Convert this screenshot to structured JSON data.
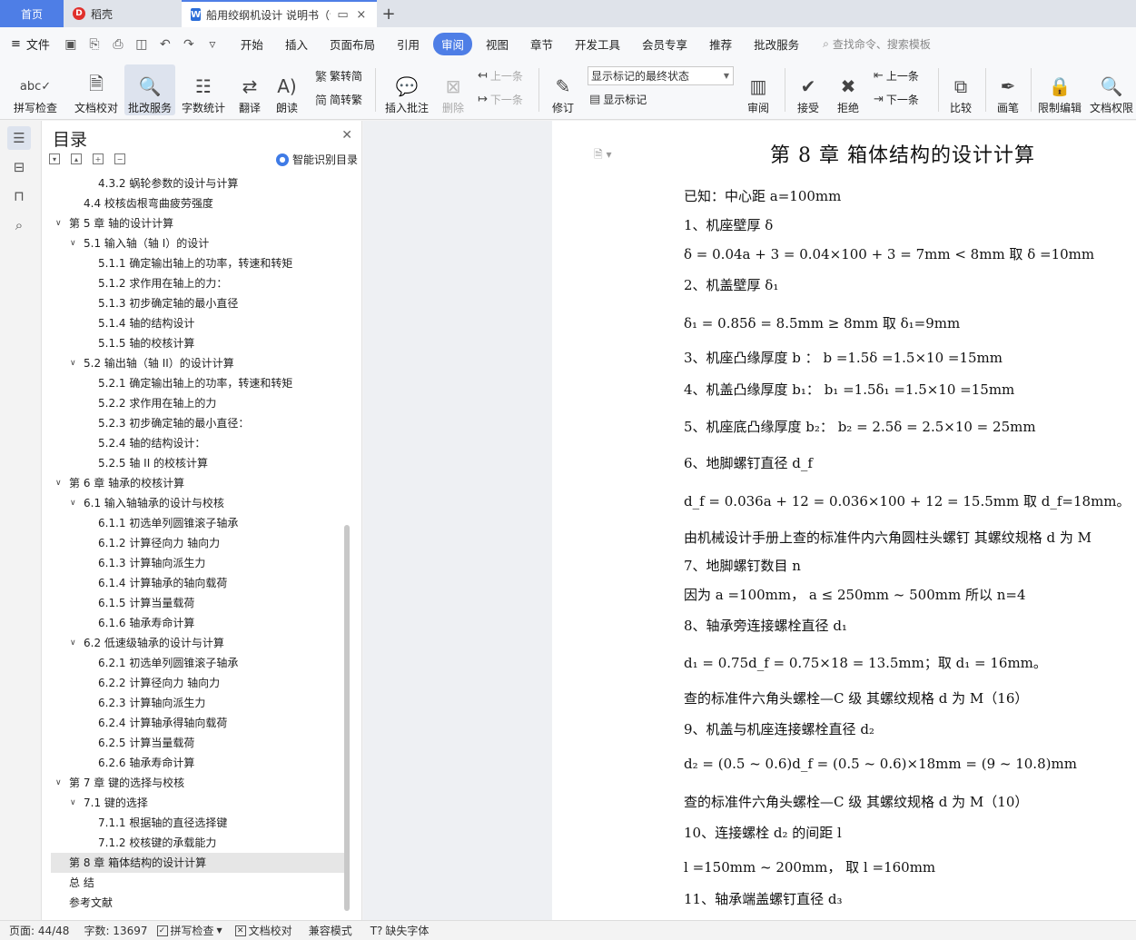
{
  "tabs": {
    "home": "首页",
    "daoke": "稻壳",
    "doc": "船用绞纲机设计 说明书（论文）",
    "add": "+"
  },
  "menu": {
    "file": "文件",
    "items": [
      "开始",
      "插入",
      "页面布局",
      "引用",
      "审阅",
      "视图",
      "章节",
      "开发工具",
      "会员专享",
      "推荐",
      "批改服务"
    ],
    "active": "审阅",
    "search": "查找命令、搜索模板"
  },
  "ribbon": {
    "spellcheck": "拼写检查",
    "doc_check": "文档校对",
    "review_service": "批改服务",
    "word_count": "字数统计",
    "translate": "翻译",
    "read_aloud": "朗读",
    "to_simplified": "繁转简",
    "to_traditional": "简转繁",
    "insert_comment": "插入批注",
    "delete": "删除",
    "prev": "上一条",
    "next": "下一条",
    "revise": "修订",
    "markup_combo": "显示标记的最终状态",
    "show_markup": "显示标记",
    "review": "审阅",
    "accept": "接受",
    "reject": "拒绝",
    "prev2": "上一条",
    "next2": "下一条",
    "compare": "比较",
    "pen": "画笔",
    "restrict_edit": "限制编辑",
    "doc_permission": "文档权限"
  },
  "toc": {
    "title": "目录",
    "smart": "智能识别目录",
    "items": [
      {
        "t": "4.3.2   蜗轮参数的设计与计算",
        "lvl": 3
      },
      {
        "t": "4.4   校核齿根弯曲疲劳强度",
        "lvl": 2
      },
      {
        "t": "第 5 章   轴的设计计算",
        "lvl": 1,
        "chev": true
      },
      {
        "t": "5.1   输入轴（轴 I）的设计",
        "lvl": 2,
        "chev": true
      },
      {
        "t": "5.1.1   确定输出轴上的功率，转速和转矩",
        "lvl": 3
      },
      {
        "t": "5.1.2   求作用在轴上的力：",
        "lvl": 3
      },
      {
        "t": "5.1.3   初步确定轴的最小直径",
        "lvl": 3
      },
      {
        "t": "5.1.4   轴的结构设计",
        "lvl": 3
      },
      {
        "t": "5.1.5   轴的校核计算",
        "lvl": 3
      },
      {
        "t": "5.2   输出轴（轴 II）的设计计算",
        "lvl": 2,
        "chev": true
      },
      {
        "t": "5.2.1   确定输出轴上的功率，转速和转矩",
        "lvl": 3
      },
      {
        "t": "5.2.2   求作用在轴上的力",
        "lvl": 3
      },
      {
        "t": "5.2.3   初步确定轴的最小直径：",
        "lvl": 3
      },
      {
        "t": "5.2.4   轴的结构设计：",
        "lvl": 3
      },
      {
        "t": "5.2.5   轴 II 的校核计算",
        "lvl": 3
      },
      {
        "t": "第 6 章   轴承的校核计算",
        "lvl": 1,
        "chev": true
      },
      {
        "t": "6.1  输入轴轴承的设计与校核",
        "lvl": 2,
        "chev": true
      },
      {
        "t": "6.1.1   初选单列圆锥滚子轴承",
        "lvl": 3
      },
      {
        "t": "6.1.2   计算径向力    轴向力",
        "lvl": 3
      },
      {
        "t": "6.1.3   计算轴向派生力",
        "lvl": 3
      },
      {
        "t": "6.1.4   计算轴承的轴向载荷",
        "lvl": 3
      },
      {
        "t": "6.1.5  计算当量载荷",
        "lvl": 3
      },
      {
        "t": "6.1.6   轴承寿命计算",
        "lvl": 3
      },
      {
        "t": "6.2  低速级轴承的设计与计算",
        "lvl": 2,
        "chev": true
      },
      {
        "t": "6.2.1   初选单列圆锥滚子轴承",
        "lvl": 3
      },
      {
        "t": "6.2.2   计算径向力      轴向力",
        "lvl": 3
      },
      {
        "t": "6.2.3  计算轴向派生力",
        "lvl": 3
      },
      {
        "t": "6.2.4  计算轴承得轴向载荷",
        "lvl": 3
      },
      {
        "t": "6.2.5  计算当量载荷",
        "lvl": 3
      },
      {
        "t": "6.2.6  轴承寿命计算",
        "lvl": 3
      },
      {
        "t": "第 7 章   键的选择与校核",
        "lvl": 1,
        "chev": true
      },
      {
        "t": "7.1  键的选择",
        "lvl": 2,
        "chev": true
      },
      {
        "t": "7.1.1  根据轴的直径选择键",
        "lvl": 3
      },
      {
        "t": "7.1.2  校核键的承载能力",
        "lvl": 3
      },
      {
        "t": "第 8 章   箱体结构的设计计算",
        "lvl": 1,
        "selected": true
      },
      {
        "t": "总   结",
        "lvl": 1
      },
      {
        "t": "参考文献",
        "lvl": 1
      }
    ]
  },
  "doc": {
    "title": "第 8 章    箱体结构的设计计算",
    "lines": [
      "已知：中心距  a=100mm",
      "1、机座壁厚 δ",
      "δ = 0.04a + 3 = 0.04×100 + 3 = 7mm < 8mm                取 δ =10mm",
      "2、机盖壁厚 δ₁",
      "δ₁ = 0.85δ = 8.5mm ≥ 8mm                    取 δ₁=9mm",
      "3、机座凸缘厚度 b   ：          b =1.5δ =1.5×10 =15mm",
      "4、机盖凸缘厚度 b₁：          b₁ =1.5δ₁ =1.5×10 =15mm",
      "5、机座底凸缘厚度 b₂：      b₂ = 2.5δ = 2.5×10 = 25mm",
      "6、地脚螺钉直径 d_f",
      "d_f = 0.036a + 12 = 0.036×100 + 12 = 15.5mm     取 d_f=18mm。",
      "由机械设计手册上查的标准件内六角圆柱头螺钉     其螺纹规格 d 为 M",
      "7、地脚螺钉数目 n",
      "因为 a =100mm， a ≤ 250mm ~ 500mm          所以 n=4",
      "8、轴承旁连接螺栓直径 d₁",
      "d₁ = 0.75d_f = 0.75×18 = 13.5mm；取 d₁ = 16mm。",
      "查的标准件六角头螺栓—C 级    其螺纹规格  d 为 M（16）",
      "9、机盖与机座连接螺栓直径 d₂",
      "d₂ = (0.5 ~ 0.6)d_f = (0.5 ~ 0.6)×18mm = (9 ~ 10.8)mm",
      "查的标准件六角头螺栓—C 级    其螺纹规格  d 为 M（10）",
      "10、连接螺栓 d₂ 的间距 l",
      "l =150mm ~ 200mm， 取 l =160mm",
      "11、轴承端盖螺钉直径 d₃"
    ]
  },
  "status": {
    "page": "页面: 44/48",
    "words": "字数: 13697",
    "spell": "拼写检查",
    "doc_check": "文档校对",
    "compat": "兼容模式",
    "missing_font": "缺失字体"
  }
}
